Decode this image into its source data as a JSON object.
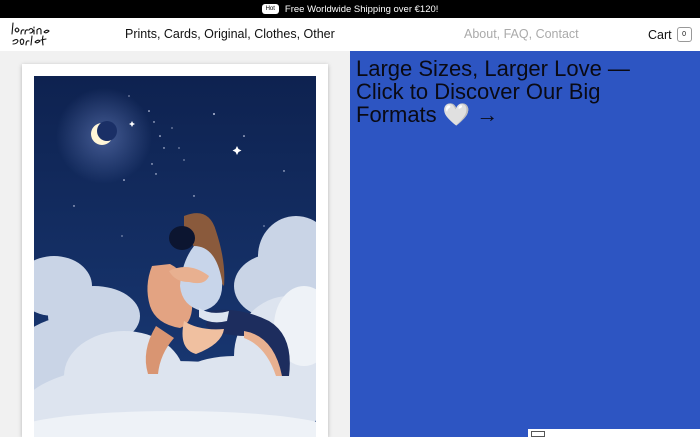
{
  "announcement": {
    "badge": "Hot",
    "text": "Free Worldwide Shipping over €120!"
  },
  "header": {
    "logo_text": "lorraine sorlet",
    "nav_main": "Prints, Cards, Original, Clothes, Other",
    "nav_info": "About, FAQ, Contact",
    "cart_label": "Cart",
    "cart_count": "0"
  },
  "promo": {
    "text": "Large Sizes, Larger Love — Click to Discover Our Big Formats 🤍 →"
  },
  "colors": {
    "promo_bg": "#2d55c2",
    "sky": "#102452",
    "announce_bg": "#000000"
  },
  "icons": {
    "moon": "crescent-moon-icon",
    "thumbnail": "image-thumbnail-icon"
  }
}
